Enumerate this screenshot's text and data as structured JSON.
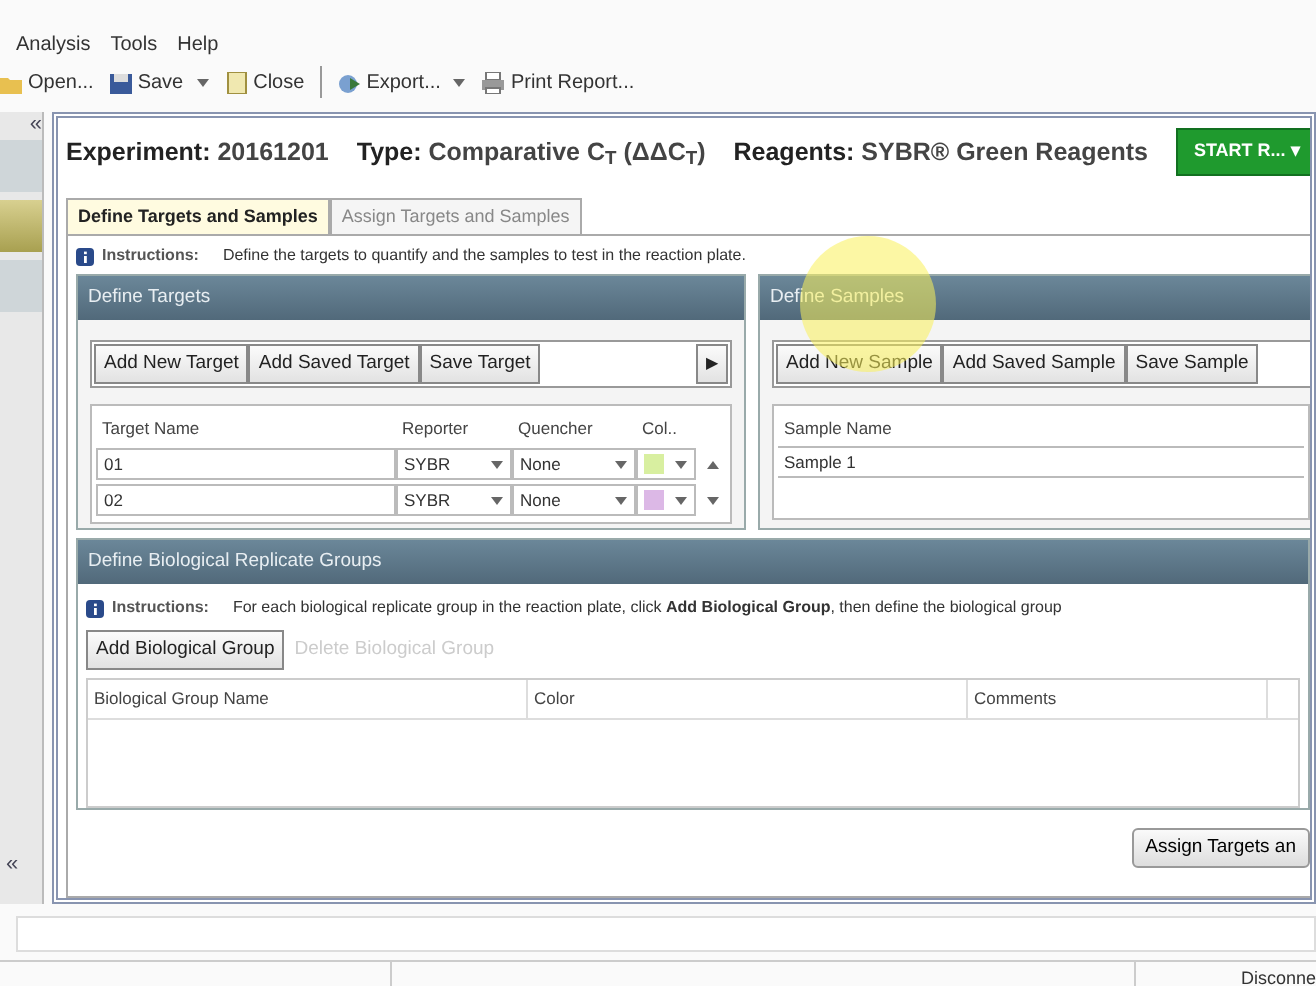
{
  "menu": [
    "Analysis",
    "Tools",
    "Help"
  ],
  "toolbar": [
    {
      "label": "Open...",
      "dropdown": false
    },
    {
      "label": "Save",
      "dropdown": true
    },
    {
      "label": "Close",
      "dropdown": false
    },
    {
      "label": "Export...",
      "dropdown": true
    },
    {
      "label": "Print Report...",
      "dropdown": false
    }
  ],
  "sidebar": {
    "collapse_top": "«",
    "collapse_bottom": "«",
    "items": [
      {
        "selected": false
      },
      {
        "selected": true
      },
      {
        "selected": false
      }
    ]
  },
  "header": {
    "experiment_label": "Experiment:",
    "experiment": "20161201",
    "type_label": "Type:",
    "type": "Comparative C$_{T}$ (ΔΔC$_{T}$)",
    "reagents_label": "Reagents:",
    "reagents": "SYBR® Green Reagents",
    "start_button": "START R... ▾"
  },
  "tabs": [
    {
      "label": "Define Targets and Samples",
      "selected": true
    },
    {
      "label": "Assign Targets and Samples",
      "selected": false
    }
  ],
  "instructions": {
    "label": "Instructions:",
    "text": "Define the targets to quantify and the samples to test in the reaction plate."
  },
  "targets": {
    "title": "Define Targets",
    "buttons": [
      "Add New Target",
      "Add Saved Target",
      "Save Target"
    ],
    "more": "▶",
    "columns": [
      "Target Name",
      "Reporter",
      "Quencher",
      "Col.."
    ],
    "rows": [
      {
        "name": "01",
        "reporter": "SYBR",
        "quencher": "None",
        "color": "#d8efa0"
      },
      {
        "name": "02",
        "reporter": "SYBR",
        "quencher": "None",
        "color": "#dcb8e6"
      }
    ]
  },
  "samples": {
    "title": "Define Samples",
    "buttons": [
      "Add New Sample",
      "Add Saved Sample",
      "Save Sample"
    ],
    "columns": [
      "Sample Name"
    ],
    "rows": [
      "Sample 1"
    ]
  },
  "groups": {
    "title": "Define Biological Replicate Groups",
    "instructions_label": "Instructions:",
    "instructions": "For each biological replicate group in the reaction plate, click **Add Biological Group**, then define the biological group",
    "buttons": [
      {
        "label": "Add Biological Group",
        "disabled": false
      },
      {
        "label": "Delete Biological Group",
        "disabled": true
      }
    ],
    "columns": [
      "Biological Group Name",
      "Color",
      "Comments"
    ]
  },
  "assign_button": "Assign Targets an",
  "status_bar": {
    "connection": "Disconne"
  }
}
